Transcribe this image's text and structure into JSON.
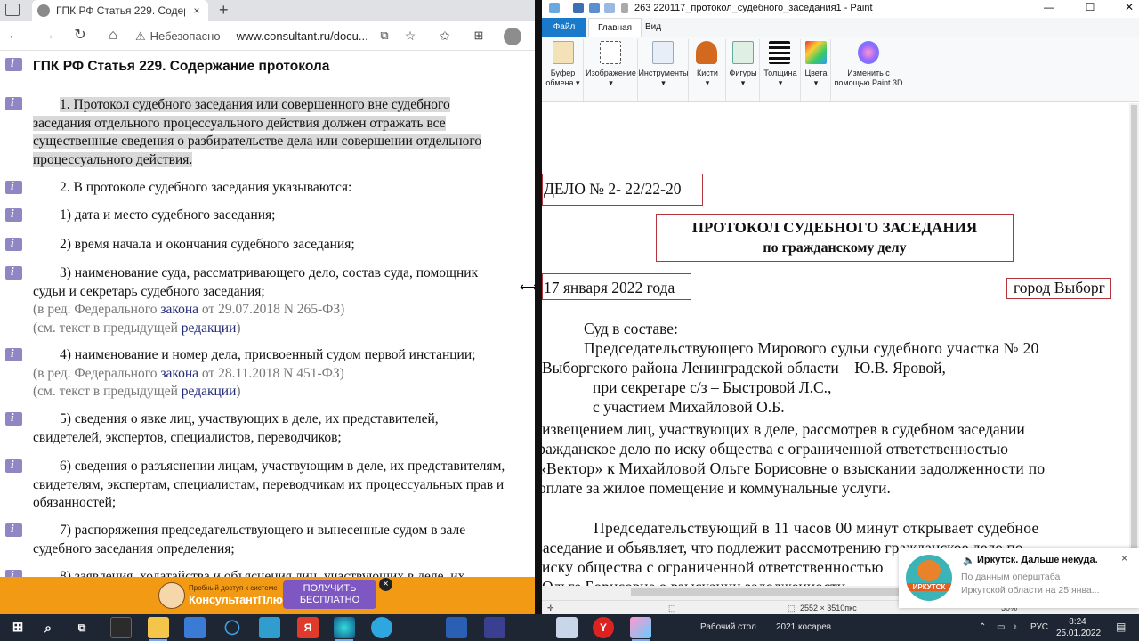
{
  "browser": {
    "tab_title": "ГПК РФ Статья 229. Содержание",
    "tab_close": "×",
    "new_tab": "+",
    "address_security": "Небезопасно",
    "address_url": "www.consultant.ru/docu...",
    "nav": {
      "back": "←",
      "forward": "→",
      "reload": "↻",
      "home": "⌂"
    }
  },
  "article": {
    "title": "ГПК РФ Статья 229. Содержание протокола",
    "p1_lines": [
      "1. Протокол судебного заседания или совершенного вне судебного",
      "заседания отдельного процессуального действия должен отражать все",
      "существенные сведения о разбирательстве дела или совершении отдельного",
      "процессуального действия."
    ],
    "p2": "2. В протоколе судебного заседания указываются:",
    "item1": "1) дата и место судебного заседания;",
    "item2": "2) время начала и окончания судебного заседания;",
    "item3_lines": [
      "3) наименование суда, рассматривающего дело, состав суда, помощник",
      "судьи и секретарь судебного заседания;"
    ],
    "item3_edit_pre": "(в ред. Федерального ",
    "item3_edit_link": "закона",
    "item3_edit_post": " от 29.07.2018 N 265-ФЗ)",
    "see_pre": "(см. текст в предыдущей ",
    "see_link": "редакции",
    "see_post": ")",
    "item4": "4) наименование и номер дела, присвоенный судом первой инстанции;",
    "item4_edit_pre": "(в ред. Федерального ",
    "item4_edit_link": "закона",
    "item4_edit_post": " от 28.11.2018 N 451-ФЗ)",
    "item5_lines": [
      "5) сведения о явке лиц, участвующих в деле, их представителей,",
      "свидетелей, экспертов, специалистов, переводчиков;"
    ],
    "item6_lines": [
      "6) сведения о разъяснении лицам, участвующим в деле, их представителям,",
      "свидетелям, экспертам, специалистам, переводчикам их процессуальных прав и",
      "обязанностей;"
    ],
    "item7_lines": [
      "7) распоряжения председательствующего и вынесенные судом в зале",
      "судебного заседания определения;"
    ],
    "item8_partial": "8) заявления, ходатайства и объяснения лиц, участвующих в деле, их"
  },
  "promo": {
    "line1": "Пробный доступ к системе",
    "brand": "КонсультантПлюс",
    "button": [
      "ПОЛУЧИТЬ",
      "БЕСПЛАТНО"
    ],
    "close": "×"
  },
  "paint": {
    "title": "263 220117_протокол_судебного_заседания1 - Paint",
    "tabs": [
      "Файл",
      "Главная",
      "Вид"
    ],
    "groups": [
      {
        "label": [
          "Буфер",
          "обмена ▾"
        ]
      },
      {
        "label": [
          "Изображение",
          "▾"
        ]
      },
      {
        "label": [
          "Инструменты",
          "▾"
        ]
      },
      {
        "label": [
          "Кисти",
          "▾"
        ]
      },
      {
        "label": [
          "Фигуры",
          "▾"
        ]
      },
      {
        "label": [
          "Толщина",
          "▾"
        ]
      },
      {
        "label": [
          "Цвета",
          "▾"
        ]
      },
      {
        "label": [
          "Изменить с",
          "помощью Paint 3D"
        ]
      }
    ],
    "doc": {
      "case_no": "ДЕЛО № 2- 22/22-20",
      "heading": "ПРОТОКОЛ СУДЕБНОГО ЗАСЕДАНИЯ",
      "subheading": "по гражданскому делу",
      "date": "17 января 2022 года",
      "city": "город  Выборг",
      "court_head": "Суд в составе:",
      "lines": [
        "Председательствующего Мирового судьи судебного участка № 20",
        "Выборгского района Ленинградской области – Ю.В. Яровой,",
        "при секретаре с/з – Быстровой Л.С.,",
        "с участием Михайловой О.Б.",
        "с извещением лиц, участвующих в деле, рассмотрев в судебном заседании",
        "гражданское дело по иску общества с ограниченной ответственностью",
        "«Вектор» к Михайловой Ольге Борисовне о взыскании задолженности по",
        "оплате за жилое помещение и коммунальные услуги.",
        "Председательствующий в 11 часов 00 минут  открывает судебное",
        "заседание и объявляет, что подлежит рассмотрению гражданское дело по",
        "иску общества с ограниченной ответственностью",
        "Ольге Борисовне о взыскании задолженности"
      ]
    },
    "status_size": "2552 × 3510пкс",
    "zoom": "50%"
  },
  "notification": {
    "title": "Иркутск. Дальше некуда.",
    "line1": "По данным оперштаба",
    "line2": "Иркутской области на 25 янва...",
    "avatar_label": "ИРКУТСК",
    "close": "×"
  },
  "taskbar": {
    "desktop": "Рабочий стол",
    "folder": "2021 косарев",
    "lang": "РУС",
    "time": "8:24",
    "date": "25.01.2022"
  }
}
